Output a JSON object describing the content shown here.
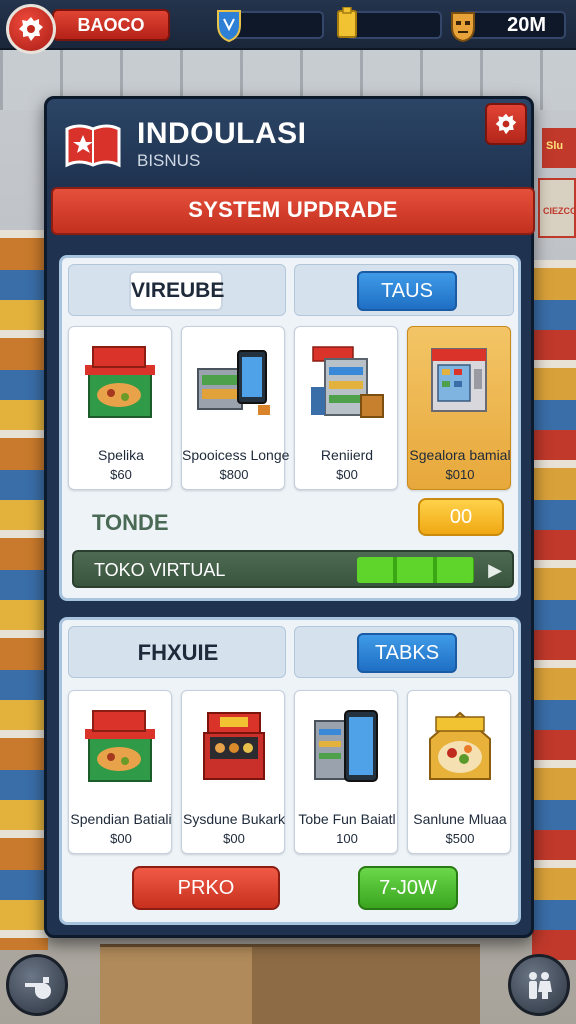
{
  "hud": {
    "player_name": "BAOCO",
    "resource_value": "20M"
  },
  "panel": {
    "title": "INDOULASI",
    "subtitle": "BISNUS",
    "banner": "SYSTEM UPDRADE"
  },
  "section1": {
    "tab_left": "VIREUBE",
    "tab_right": "TAUS",
    "cards": [
      {
        "name": "Spelika",
        "price": "$60"
      },
      {
        "name": "Spooicess Longe",
        "price": "$800"
      },
      {
        "name": "Reniierd",
        "price": "$00"
      },
      {
        "name": "Sgealora bamial",
        "price": "$010"
      }
    ],
    "stat_label": "TONDE",
    "stat_button": "00",
    "progress_label": "TOKO VIRTUAL",
    "progress_fraction": 0.3
  },
  "section2": {
    "tab_left": "FHXUIE",
    "tab_right": "TABKS",
    "cards": [
      {
        "name": "Spendian Batiali",
        "price": "$00"
      },
      {
        "name": "Sysdune Bukark",
        "price": "$00"
      },
      {
        "name": "Tobe Fun Baiatl",
        "price": "100"
      },
      {
        "name": "Sanlune Mluaa",
        "price": "$500"
      }
    ],
    "button_red": "PRKO",
    "button_green": "7-J0W"
  },
  "background": {
    "sign_1": "Slu",
    "sign_2": "CIEZCO"
  },
  "colors": {
    "accent_red": "#d63a29",
    "accent_blue": "#2f86d8",
    "accent_green": "#4cc12a",
    "accent_yellow": "#f5b922",
    "panel_navy": "#1f3350"
  },
  "icons": [
    "gear-icon",
    "shield-icon",
    "trophy-icon",
    "mask-icon",
    "book-logo-icon",
    "whistle-icon",
    "family-icon"
  ]
}
